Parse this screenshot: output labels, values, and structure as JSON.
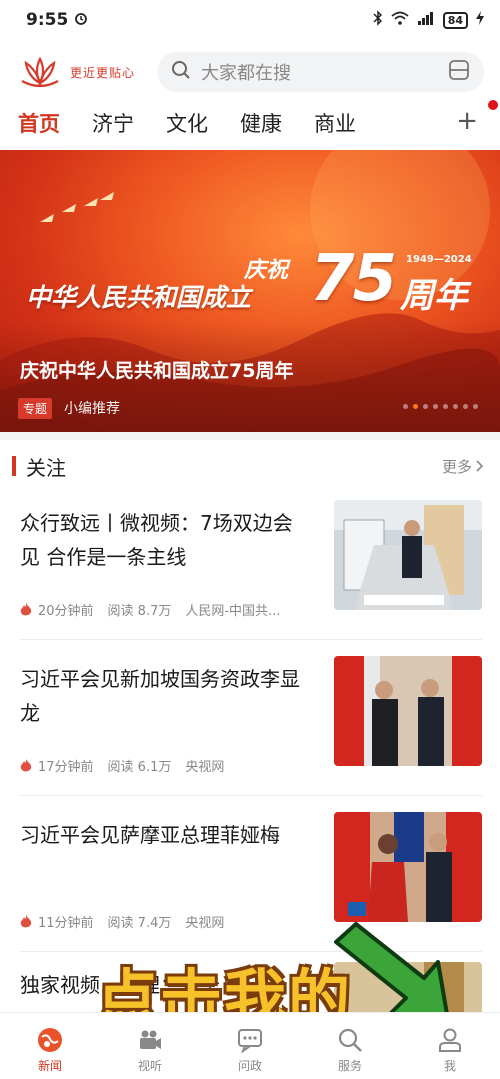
{
  "status_bar": {
    "time": "9:55",
    "battery": "84"
  },
  "header": {
    "slogan": "更近更贴心",
    "search_placeholder": "大家都在搜"
  },
  "channels": {
    "tabs": [
      "首页",
      "济宁",
      "文化",
      "健康",
      "商业"
    ],
    "add_label": "+"
  },
  "banner": {
    "art_title_small": "庆祝",
    "art_title_main": "中华人民共和国成立",
    "art_number": "75",
    "art_suffix": "周年",
    "art_years": "1949—2024",
    "caption": "庆祝中华人民共和国成立75周年",
    "tag": "专题",
    "source": "小编推荐",
    "slide_count": 8,
    "active_slide": 1
  },
  "section": {
    "title": "关注",
    "more": "更多"
  },
  "news": [
    {
      "title": "众行致远丨微视频：7场双边会见 合作是一条主线",
      "time": "20分钟前",
      "reads": "阅读 8.7万",
      "source": "人民网-中国共..."
    },
    {
      "title": "习近平会见新加坡国务资政李显龙",
      "time": "17分钟前",
      "reads": "阅读 6.1万",
      "source": "央视网"
    },
    {
      "title": "习近平会见萨摩亚总理菲娅梅",
      "time": "11分钟前",
      "reads": "阅读 7.4万",
      "source": "央视网"
    },
    {
      "title": "独家视频……理：一个",
      "time": "",
      "reads": "",
      "source": ""
    }
  ],
  "bottom_nav": [
    "新闻",
    "视听",
    "问政",
    "服务",
    "我"
  ],
  "overlay": {
    "text": "点击我的"
  },
  "colors": {
    "accent": "#d2371f",
    "banner_red": "#d43417",
    "overlay_yellow": "#f7c229",
    "arrow_green": "#3ca53a"
  },
  "icons": [
    "alarm-icon",
    "bluetooth-icon",
    "wifi-icon",
    "signal-icon",
    "battery-icon",
    "search-icon",
    "scan-icon",
    "fire-icon",
    "news-nav-icon",
    "video-nav-icon",
    "chat-nav-icon",
    "search-nav-icon",
    "user-nav-icon"
  ]
}
